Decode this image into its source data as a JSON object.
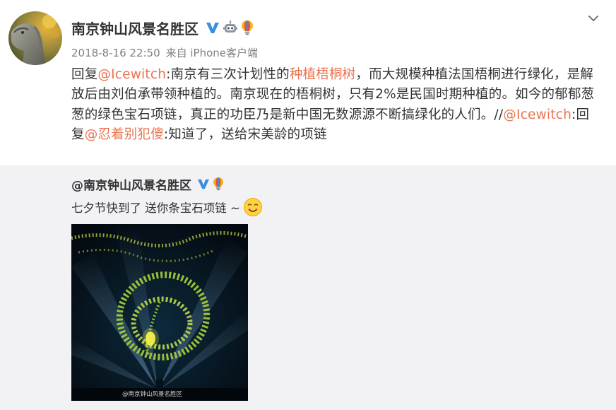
{
  "post": {
    "author": "南京钟山风景名胜区",
    "timestamp": "2018-8-16 22:50",
    "source": "来自 iPhone客户端",
    "badges": [
      "verified-v-icon",
      "robot-icon",
      "lightbulb-icon"
    ],
    "reply": {
      "prefix": "回复",
      "mention1": "@Icewitch",
      "text1": ":南京有三次计划性的",
      "topic": "种植梧桐树",
      "text2": "，而大规模种植法国梧桐进行绿化，是解放后由刘伯承带领种植的。南京现在的梧桐树，只有2%是民国时期种植的。如今的郁郁葱葱的绿色宝石项链，真正的功臣乃是新中国无数源源不断搞绿化的人们。//",
      "mention2": "@Icewitch",
      "text3": ":回复",
      "mention3": "@忍着别犯傻",
      "text4": ":知道了，送给宋美龄的项链"
    }
  },
  "quoted": {
    "author": "@南京钟山风景名胜区",
    "text": "七夕节快到了 送你条宝石项链 ~",
    "emoji": "smile-emoji-icon",
    "image_watermark": "@南京钟山风景名胜区"
  },
  "colors": {
    "link": "#eb7350",
    "text": "#333333",
    "meta": "#808080",
    "quote_bg": "#f2f2f5",
    "verified": "#3a8fe0"
  }
}
